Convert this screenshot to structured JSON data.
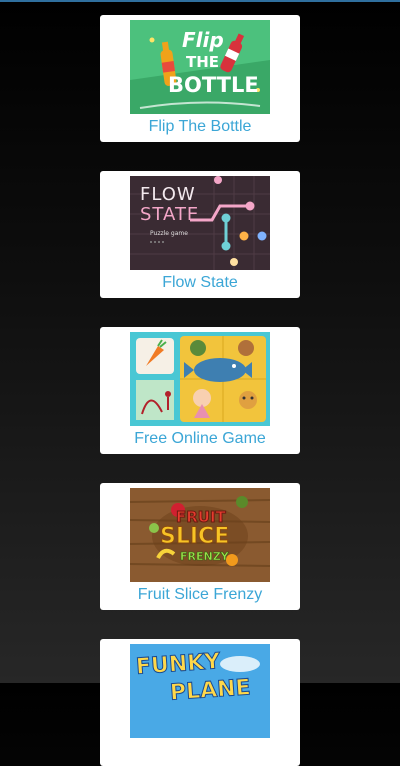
{
  "games": [
    {
      "title": "Flip The Bottle",
      "logo_lines": [
        "Flip",
        "THE",
        "BOTTLE"
      ]
    },
    {
      "title": "Flow State",
      "logo_lines": [
        "FLOW",
        "STATE"
      ],
      "subtitle": "Puzzle game"
    },
    {
      "title": "Free Online Game"
    },
    {
      "title": "Fruit Slice Frenzy",
      "logo_lines": [
        "FRUIT",
        "SLICE",
        "FRENZY"
      ]
    },
    {
      "title": "",
      "logo_lines": [
        "FUNKY",
        "PLANE"
      ]
    }
  ],
  "colors": {
    "title": "#3ba6d6",
    "topline": "#2f6f9e"
  }
}
